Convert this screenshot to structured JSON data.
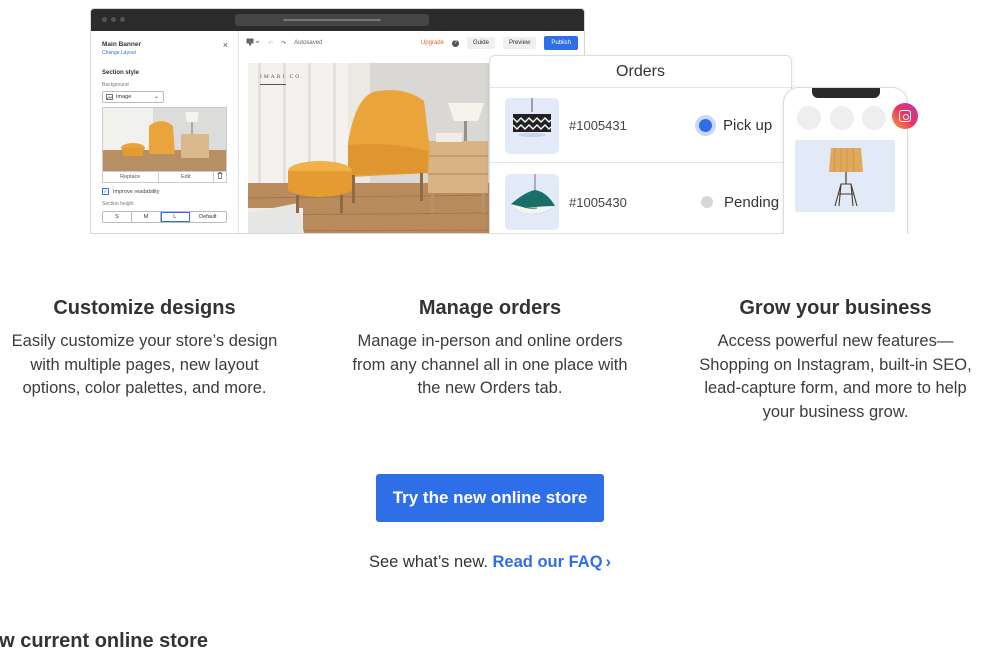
{
  "editor": {
    "left_panel": {
      "title": "Main Banner",
      "change_layout_link": "Change Layout",
      "section_style_heading": "Section style",
      "background_label": "Background",
      "background_value": "Image",
      "replace_button": "Replace",
      "edit_button": "Edit",
      "improve_readability_label": "Improve readability",
      "improve_readability_checked": true,
      "section_height_label": "Section height",
      "section_height_options": [
        "S",
        "M",
        "L",
        "Default"
      ],
      "section_height_selected": "L"
    },
    "toolbar": {
      "autosaved_label": "Autosaved",
      "upgrade_label": "Upgrade",
      "help_icon": "?",
      "guide_label": "Guide",
      "preview_label": "Preview",
      "publish_label": "Publish"
    },
    "canvas": {
      "brand_text": "IMARI CO."
    }
  },
  "orders_card": {
    "title": "Orders",
    "rows": [
      {
        "order_id": "#1005431",
        "status": "Pick up",
        "status_active": true
      },
      {
        "order_id": "#1005430",
        "status": "Pending",
        "status_active": false
      }
    ]
  },
  "features": [
    {
      "title": "Customize designs",
      "description": "Easily customize your store’s design with multiple pages, new layout options, color palettes, and more."
    },
    {
      "title": "Manage orders",
      "description": "Manage in-person and online orders from any channel all in one place with the new Orders tab."
    },
    {
      "title": "Grow your business",
      "description": "Access powerful new features—Shopping on Instagram, built-in SEO, lead-capture form, and more to help your business grow."
    }
  ],
  "cta": {
    "button_label": "Try the new online store",
    "faq_prefix": "See what’s new.",
    "faq_link": "Read our FAQ",
    "faq_chevron": "›"
  },
  "footer_heading": "ew current online store",
  "colors": {
    "accent": "#2e6ee6",
    "upgrade": "#e06a1a",
    "mustard": "#e9a53c",
    "dark_chrome": "#2b2b2b"
  },
  "icons": {
    "close": "×",
    "check": "✓",
    "undo": "↶",
    "redo": "↷",
    "trash": "trash-icon",
    "instagram": "instagram-icon"
  }
}
